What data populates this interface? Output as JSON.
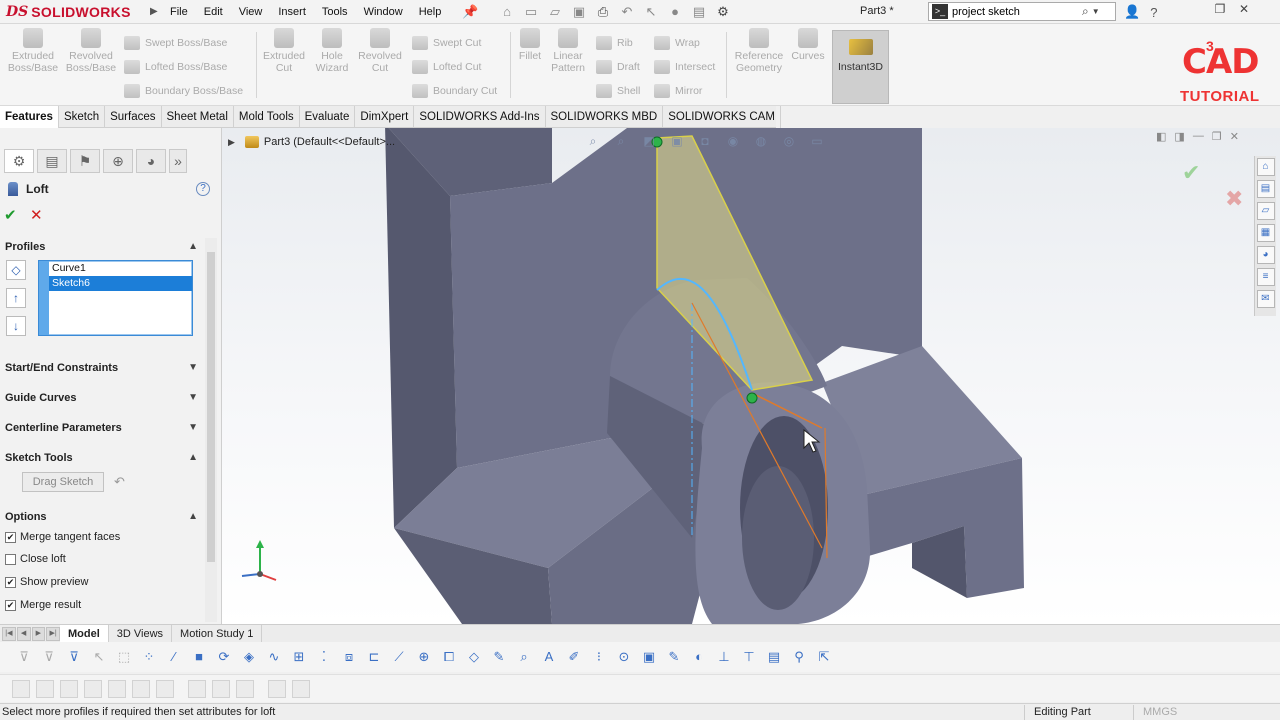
{
  "app": {
    "brand_prefix": "DS",
    "brand": "SOLIDWORKS",
    "doc_title": "Part3 *"
  },
  "menu": [
    "File",
    "Edit",
    "View",
    "Insert",
    "Tools",
    "Window",
    "Help"
  ],
  "search": {
    "value": "project sketch"
  },
  "command_manager": {
    "big": [
      {
        "label": "Extruded\nBoss/Base",
        "icon": "extruded-boss-icon"
      },
      {
        "label": "Revolved\nBoss/Base",
        "icon": "revolved-boss-icon"
      },
      {
        "label": "Extruded\nCut",
        "icon": "extruded-cut-icon"
      },
      {
        "label": "Hole\nWizard",
        "icon": "hole-wizard-icon"
      },
      {
        "label": "Revolved\nCut",
        "icon": "revolved-cut-icon"
      },
      {
        "label": "Fillet",
        "icon": "fillet-icon"
      },
      {
        "label": "Linear\nPattern",
        "icon": "linear-pattern-icon"
      },
      {
        "label": "Reference\nGeometry",
        "icon": "reference-geometry-icon"
      },
      {
        "label": "Curves",
        "icon": "curves-icon"
      }
    ],
    "small_boss": [
      "Swept Boss/Base",
      "Lofted Boss/Base",
      "Boundary Boss/Base"
    ],
    "small_cut": [
      "Swept Cut",
      "Lofted Cut",
      "Boundary Cut"
    ],
    "small_ops1": [
      "Rib",
      "Draft",
      "Shell"
    ],
    "small_ops2": [
      "Wrap",
      "Intersect",
      "Mirror"
    ],
    "instant3d": "Instant3D"
  },
  "watermark": {
    "line1": "CAD",
    "sup": "3",
    "line2": "TUTORIAL"
  },
  "tabs": [
    "Features",
    "Sketch",
    "Surfaces",
    "Sheet Metal",
    "Mold Tools",
    "Evaluate",
    "DimXpert",
    "SOLIDWORKS Add-Ins",
    "SOLIDWORKS MBD",
    "SOLIDWORKS CAM"
  ],
  "property_manager": {
    "title": "Loft",
    "profiles_header": "Profiles",
    "profiles": [
      "Curve1",
      "Sketch6"
    ],
    "sections": [
      "Start/End Constraints",
      "Guide Curves",
      "Centerline Parameters"
    ],
    "sketch_tools_header": "Sketch Tools",
    "drag_sketch": "Drag Sketch",
    "options_header": "Options",
    "options": [
      {
        "label": "Merge tangent faces",
        "checked": true
      },
      {
        "label": "Close loft",
        "checked": false
      },
      {
        "label": "Show preview",
        "checked": true
      },
      {
        "label": "Merge result",
        "checked": true
      }
    ]
  },
  "viewport": {
    "tree_label": "Part3  (Default<<Default>..."
  },
  "bottom_tabs": [
    "Model",
    "3D Views",
    "Motion Study 1"
  ],
  "status": {
    "message": "Select more profiles if required then set attributes for loft",
    "mode": "Editing Part",
    "units": "MMGS"
  },
  "colors": {
    "brand": "#c8102e",
    "model": "#6e7289",
    "preview": "#e8e08a",
    "accent": "#1c7ed8"
  }
}
